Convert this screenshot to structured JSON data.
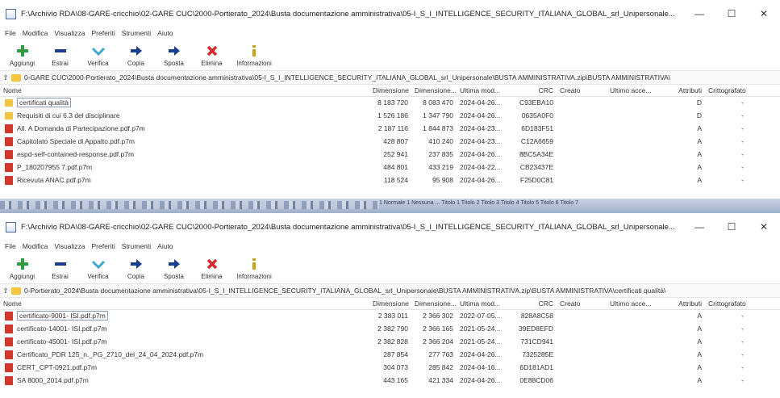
{
  "menu": [
    "File",
    "Modifica",
    "Visualizza",
    "Preferiti",
    "Strumenti",
    "Aiuto"
  ],
  "toolbar": {
    "add": "Aggiungi",
    "extract": "Estrai",
    "test": "Verifica",
    "copy": "Copia",
    "move": "Sposta",
    "delete": "Elimina",
    "info": "Informazioni"
  },
  "columns": {
    "name": "Nome",
    "size": "Dimensione",
    "packed": "Dimensione...",
    "modified": "Ultima mod...",
    "crc": "CRC",
    "created": "Creato",
    "accessed": "Ultimo acce...",
    "attributes": "Attributi",
    "encrypted": "Crittografato"
  },
  "colors": {
    "folder": "#f2c341",
    "archive_icon": "#d03a2e",
    "add_icon": "#2e9e3e",
    "delete_icon": "#d62b2b",
    "move_icon": "#1a3f8f"
  },
  "window1": {
    "title": "F:\\Archivio RDA\\08-GARE-cricchio\\02-GARE CUC\\2000-Portierato_2024\\Busta documentazione amministrativa\\05-I_S_I_INTELLIGENCE_SECURITY_ITALIANA_GLOBAL_srl_Unipersonale...",
    "path": "0-GARE CUC\\2000-Portierato_2024\\Busta documentazione amministrativa\\05-I_S_I_INTELLIGENCE_SECURITY_ITALIANA_GLOBAL_srl_Unipersonale\\BUSTA AMMINISTRATIVA.zip\\BUSTA AMMINISTRATIVA\\",
    "rows": [
      {
        "name": "certificati qualità",
        "icon": "folder",
        "size": "8 183 720",
        "packed": "8 083 470",
        "modified": "2024-04-26...",
        "crc": "C93EBA10",
        "created": "",
        "accessed": "",
        "attributes": "D",
        "encrypted": "-"
      },
      {
        "name": "Requisiti di cui 6.3 del disciplinare",
        "icon": "folder",
        "size": "1 526 186",
        "packed": "1 347 790",
        "modified": "2024-04-26...",
        "crc": "0635A0F0",
        "created": "",
        "accessed": "",
        "attributes": "D",
        "encrypted": "-"
      },
      {
        "name": "All. A Domanda di Partecipazione.pdf.p7m",
        "icon": "archive",
        "size": "2 187 116",
        "packed": "1 844 873",
        "modified": "2024-04-23...",
        "crc": "6D183F51",
        "created": "",
        "accessed": "",
        "attributes": "A",
        "encrypted": "-"
      },
      {
        "name": "Capitolato Speciale di Appalto.pdf.p7m",
        "icon": "archive",
        "size": "428 807",
        "packed": "410 240",
        "modified": "2024-04-23...",
        "crc": "C12A6659",
        "created": "",
        "accessed": "",
        "attributes": "A",
        "encrypted": "-"
      },
      {
        "name": "espd-self-contained-response.pdf.p7m",
        "icon": "archive",
        "size": "252 941",
        "packed": "237 835",
        "modified": "2024-04-26...",
        "crc": "8BC5A34E",
        "created": "",
        "accessed": "",
        "attributes": "A",
        "encrypted": "-"
      },
      {
        "name": "P_180207955 7.pdf.p7m",
        "icon": "archive",
        "size": "484 801",
        "packed": "433 219",
        "modified": "2024-04-22...",
        "crc": "CB23437E",
        "created": "",
        "accessed": "",
        "attributes": "A",
        "encrypted": "-"
      },
      {
        "name": "Ricevuta ANAC.pdf.p7m",
        "icon": "archive",
        "size": "118 524",
        "packed": "95 908",
        "modified": "2024-04-26...",
        "crc": "F25D0C81",
        "created": "",
        "accessed": "",
        "attributes": "A",
        "encrypted": "-"
      }
    ]
  },
  "strip": {
    "styles": "1 Normale  1 Nessuna ...  Titolo 1  Titolo 2  Titolo 3  Titolo 4  Titolo 5  Titolo 6  Titolo 7"
  },
  "window2": {
    "title": "F:\\Archivio RDA\\08-GARE-cricchio\\02-GARE CUC\\2000-Portierato_2024\\Busta documentazione amministrativa\\05-I_S_I_INTELLIGENCE_SECURITY_ITALIANA_GLOBAL_srl_Unipersonale...",
    "path": "0-Portierato_2024\\Busta documentazione amministrativa\\05-I_S_I_INTELLIGENCE_SECURITY_ITALIANA_GLOBAL_srl_Unipersonale\\BUSTA AMMINISTRATIVA.zip\\BUSTA AMMINISTRATIVA\\certificati qualità\\",
    "rows": [
      {
        "name": "certificato-9001- ISI.pdf.p7m",
        "icon": "archive",
        "size": "2 383 011",
        "packed": "2 366 302",
        "modified": "2022-07-05...",
        "crc": "828A8C58",
        "created": "",
        "accessed": "",
        "attributes": "A",
        "encrypted": "-"
      },
      {
        "name": "certificato-14001- ISI.pdf.p7m",
        "icon": "archive",
        "size": "2 382 790",
        "packed": "2 366 165",
        "modified": "2021-05-24...",
        "crc": "39ED8EFD",
        "created": "",
        "accessed": "",
        "attributes": "A",
        "encrypted": "-"
      },
      {
        "name": "certificato-45001- ISI.pdf.p7m",
        "icon": "archive",
        "size": "2 382 828",
        "packed": "2 366 204",
        "modified": "2021-05-24...",
        "crc": "731CD941",
        "created": "",
        "accessed": "",
        "attributes": "A",
        "encrypted": "-"
      },
      {
        "name": "Certificato_PDR 125_n._PG_2710_del_24_04_2024.pdf.p7m",
        "icon": "archive",
        "size": "287 854",
        "packed": "277 763",
        "modified": "2024-04-26...",
        "crc": "7325285E",
        "created": "",
        "accessed": "",
        "attributes": "A",
        "encrypted": "-"
      },
      {
        "name": "CERT_CPT-0921.pdf.p7m",
        "icon": "archive",
        "size": "304 073",
        "packed": "285 842",
        "modified": "2024-04-16...",
        "crc": "6D181AD1",
        "created": "",
        "accessed": "",
        "attributes": "A",
        "encrypted": "-"
      },
      {
        "name": "SA 8000_2014.pdf.p7m",
        "icon": "archive",
        "size": "443 165",
        "packed": "421 334",
        "modified": "2024-04-26...",
        "crc": "0E88CD06",
        "created": "",
        "accessed": "",
        "attributes": "A",
        "encrypted": "-"
      }
    ]
  }
}
